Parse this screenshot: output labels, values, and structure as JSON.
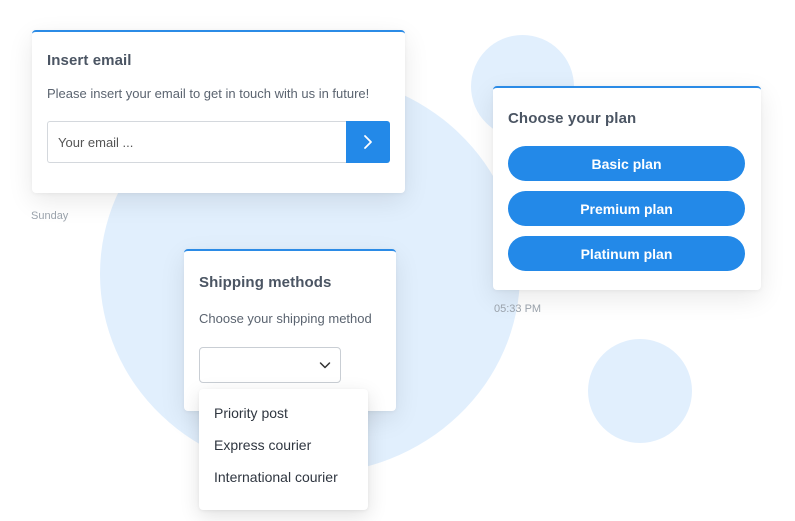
{
  "email_card": {
    "title": "Insert email",
    "description": "Please insert your email to get in touch with us in future!",
    "input_placeholder": "Your email ...",
    "submit_icon": "chevron-right-icon"
  },
  "timestamps": {
    "day": "Sunday",
    "time": "05:33 PM"
  },
  "plan_card": {
    "title": "Choose your plan",
    "buttons": [
      {
        "label": "Basic plan"
      },
      {
        "label": "Premium plan"
      },
      {
        "label": "Platinum plan"
      }
    ]
  },
  "shipping_card": {
    "title": "Shipping methods",
    "description": "Choose your shipping method",
    "selected_value": "",
    "select_icon": "chevron-down-icon",
    "options": [
      {
        "label": "Priority post"
      },
      {
        "label": "Express courier"
      },
      {
        "label": "International courier"
      }
    ]
  },
  "colors": {
    "accent": "#2389e8",
    "blob": "#e1effd"
  }
}
